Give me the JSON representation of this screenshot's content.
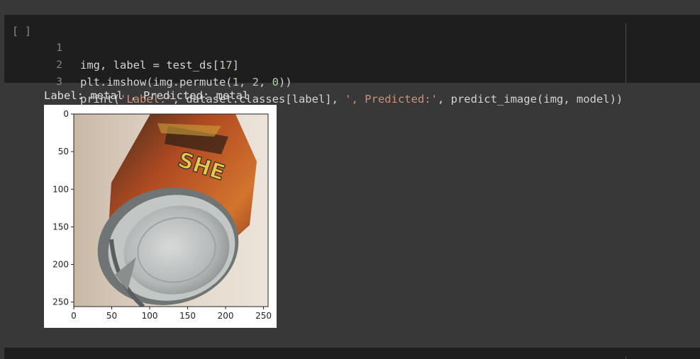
{
  "cell": {
    "run_indicator": "[ ]",
    "lines": [
      {
        "num": "1",
        "code_a": "img, label = test_ds[",
        "num_lit": "17",
        "code_b": "]"
      },
      {
        "num": "2",
        "code_a": "plt.imshow(img.permute(",
        "args": [
          "1",
          "2",
          "0"
        ],
        "code_b": "))"
      },
      {
        "num": "3",
        "code_a": "print(",
        "str1": "'Label:'",
        "code_mid": ", dataset.classes[label], ",
        "str2": "', Predicted:'",
        "code_b": ", predict_image(img, model))"
      }
    ]
  },
  "output": {
    "text": "Label: metal , Predicted: metal"
  },
  "figure": {
    "image_description": "photo of a crushed metal can",
    "x_ticks": [
      "0",
      "50",
      "100",
      "150",
      "200",
      "250"
    ],
    "y_ticks": [
      "0",
      "50",
      "100",
      "150",
      "200",
      "250"
    ],
    "xlim": [
      0,
      256
    ],
    "ylim": [
      256,
      0
    ]
  }
}
